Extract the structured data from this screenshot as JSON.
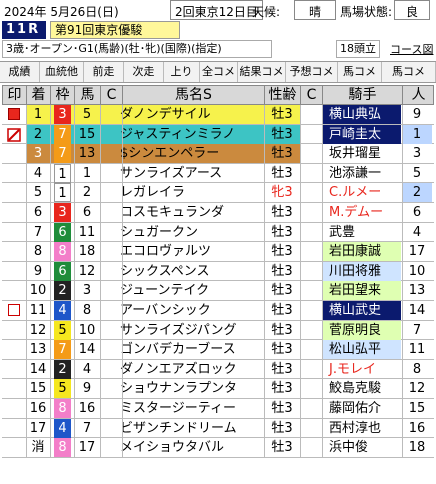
{
  "header": {
    "date": "2024年 5月26日(日)",
    "meeting": "2回東京12日目",
    "weather_label": "天候:",
    "weather": "晴",
    "going_label": "馬場状態:",
    "going": "良",
    "race_no": "11R",
    "race_name": "第91回東京優駿",
    "conditions": "3歳･オープン･G1(馬齢)(牡･牝)(国際)(指定)",
    "runners": "18頭立",
    "course_link": "コース図"
  },
  "menu": [
    "成績",
    "血統他",
    "前走",
    "次走",
    "上り",
    "全コメ",
    "結果コメ",
    "予想コメ",
    "馬コメ",
    "馬コメ"
  ],
  "columns": {
    "mark": "印",
    "rank": "着",
    "waku": "枠",
    "umaban": "馬",
    "c1": "C",
    "name": "馬名S",
    "sexage": "性齢",
    "c2": "C",
    "jockey": "騎手",
    "pop": "人"
  },
  "colors": {
    "waku1": "#ffffff",
    "waku2": "#222222",
    "waku3": "#e8261d",
    "waku4": "#1e56c9",
    "waku5": "#f5e71f",
    "waku6": "#1f8c3a",
    "waku7": "#f49b18",
    "waku8": "#f37ec9",
    "row_gold": "#f6f24c",
    "row_silver": "#3dc4c4",
    "row_bronze": "#cb8a3e",
    "jockey_navy": "#0b1a6e",
    "jockey_green": "#dfffb2",
    "jockey_blue": "#cfe4ff"
  },
  "rows": [
    {
      "mark": "◼",
      "rank": "1",
      "waku": "3",
      "umaban": "5",
      "name": "ダノンデサイル",
      "sexage": "牡3",
      "jockey": "横山典弘",
      "pop": "9"
    },
    {
      "mark": "☑",
      "rank": "2",
      "waku": "7",
      "umaban": "15",
      "name": "ジャスティンミラノ",
      "sexage": "牡3",
      "jockey": "戸崎圭太",
      "pop": "1"
    },
    {
      "mark": "",
      "rank": "3",
      "waku": "7",
      "umaban": "13",
      "name": "$シンエンペラー",
      "sexage": "牡3",
      "jockey": "坂井瑠星",
      "pop": "3"
    },
    {
      "mark": "",
      "rank": "4",
      "waku": "1",
      "umaban": "1",
      "name": "サンライズアース",
      "sexage": "牡3",
      "jockey": "池添謙一",
      "pop": "5"
    },
    {
      "mark": "",
      "rank": "5",
      "waku": "1",
      "umaban": "2",
      "name": "レガレイラ",
      "sexage": "牝3",
      "jockey": "C.ルメー",
      "pop": "2"
    },
    {
      "mark": "",
      "rank": "6",
      "waku": "3",
      "umaban": "6",
      "name": "コスモキュランダ",
      "sexage": "牡3",
      "jockey": "M.デムー",
      "pop": "6"
    },
    {
      "mark": "",
      "rank": "7",
      "waku": "6",
      "umaban": "11",
      "name": "シュガークン",
      "sexage": "牡3",
      "jockey": "武豊",
      "pop": "4"
    },
    {
      "mark": "",
      "rank": "8",
      "waku": "8",
      "umaban": "18",
      "name": "エコロヴァルツ",
      "sexage": "牡3",
      "jockey": "岩田康誠",
      "pop": "17"
    },
    {
      "mark": "",
      "rank": "9",
      "waku": "6",
      "umaban": "12",
      "name": "シックスペンス",
      "sexage": "牡3",
      "jockey": "川田将雅",
      "pop": "10"
    },
    {
      "mark": "",
      "rank": "10",
      "waku": "2",
      "umaban": "3",
      "name": "ジューンテイク",
      "sexage": "牡3",
      "jockey": "岩田望来",
      "pop": "13"
    },
    {
      "mark": "□",
      "rank": "11",
      "waku": "4",
      "umaban": "8",
      "name": "アーバンシック",
      "sexage": "牡3",
      "jockey": "横山武史",
      "pop": "14"
    },
    {
      "mark": "",
      "rank": "12",
      "waku": "5",
      "umaban": "10",
      "name": "サンライズジパング",
      "sexage": "牡3",
      "jockey": "菅原明良",
      "pop": "7"
    },
    {
      "mark": "",
      "rank": "13",
      "waku": "7",
      "umaban": "14",
      "name": "ゴンバデカーブース",
      "sexage": "牡3",
      "jockey": "松山弘平",
      "pop": "11"
    },
    {
      "mark": "",
      "rank": "14",
      "waku": "2",
      "umaban": "4",
      "name": "ダノンエアズロック",
      "sexage": "牡3",
      "jockey": "J.モレイ",
      "pop": "8"
    },
    {
      "mark": "",
      "rank": "15",
      "waku": "5",
      "umaban": "9",
      "name": "ショウナンラプンタ",
      "sexage": "牡3",
      "jockey": "鮫島克駿",
      "pop": "12"
    },
    {
      "mark": "",
      "rank": "16",
      "waku": "8",
      "umaban": "16",
      "name": "ミスタージーティー",
      "sexage": "牡3",
      "jockey": "藤岡佑介",
      "pop": "15"
    },
    {
      "mark": "",
      "rank": "17",
      "waku": "4",
      "umaban": "7",
      "name": "ビザンチンドリーム",
      "sexage": "牡3",
      "jockey": "西村淳也",
      "pop": "16"
    },
    {
      "mark": "",
      "rank": "消",
      "waku": "8",
      "umaban": "17",
      "name": "メイショウタバル",
      "sexage": "牡3",
      "jockey": "浜中俊",
      "pop": "18"
    }
  ]
}
